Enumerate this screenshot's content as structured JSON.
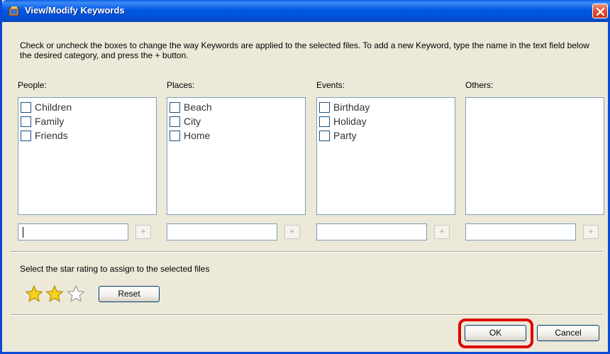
{
  "window": {
    "title": "View/Modify Keywords"
  },
  "instructions": "Check or uncheck the boxes to change the way Keywords are applied to the selected files. To add a new Keyword, type the name in the text field below the desired category, and press the + button.",
  "categories": [
    {
      "label": "People:",
      "items": [
        "Children",
        "Family",
        "Friends"
      ],
      "input_value": ""
    },
    {
      "label": "Places:",
      "items": [
        "Beach",
        "City",
        "Home"
      ],
      "input_value": ""
    },
    {
      "label": "Events:",
      "items": [
        "Birthday",
        "Holiday",
        "Party"
      ],
      "input_value": ""
    },
    {
      "label": "Others:",
      "items": [],
      "input_value": ""
    }
  ],
  "add_label": "+",
  "rating": {
    "label": "Select the star rating to assign to the selected files",
    "value": 2,
    "max": 3,
    "reset_label": "Reset"
  },
  "buttons": {
    "ok_label": "OK",
    "cancel_label": "Cancel"
  },
  "colors": {
    "titlebar": "#0058e6",
    "dialog_bg": "#ece9d8",
    "list_border": "#7f9db9",
    "star_filled": "#f7d21c",
    "star_empty": "#ffffff",
    "highlight": "#e00000"
  },
  "icons": {
    "title": "app-icon",
    "close": "close-icon",
    "star": "star-icon"
  }
}
